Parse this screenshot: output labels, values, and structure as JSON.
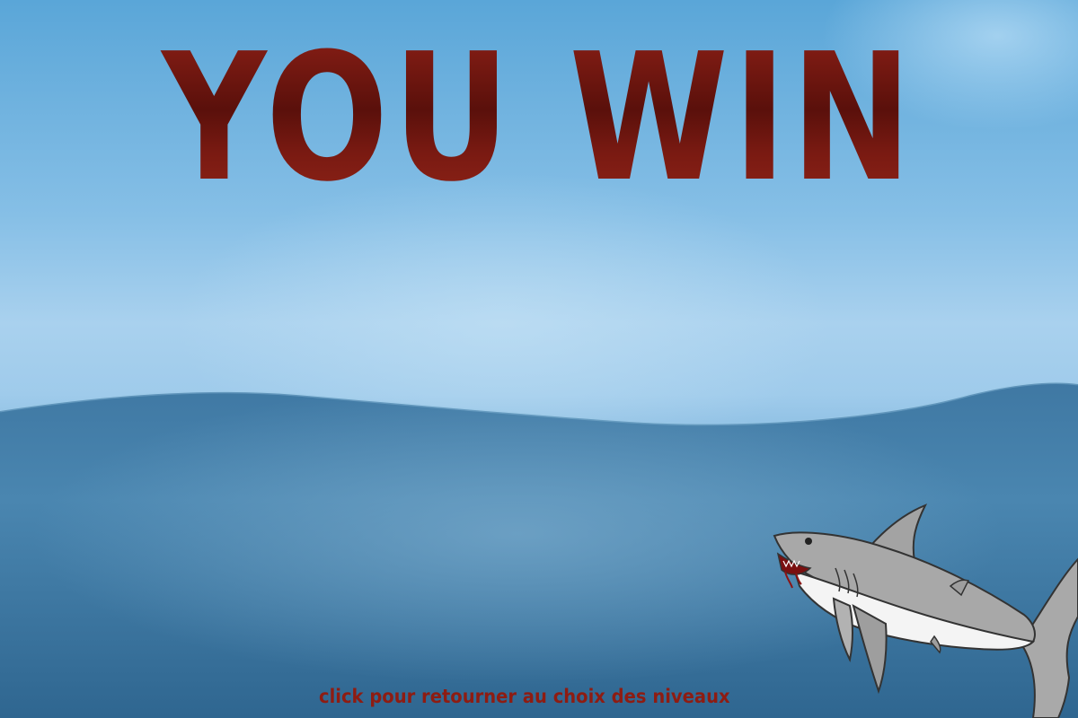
{
  "screen": {
    "title": "YOU WIN",
    "back_link": "click pour retourner au choix des niveaux"
  },
  "colors": {
    "title": "#6e1610",
    "link": "#8e1c12",
    "sky": "#86bfe6",
    "sea": "#3f77a0"
  },
  "icons": {
    "mascot": "shark-icon"
  }
}
